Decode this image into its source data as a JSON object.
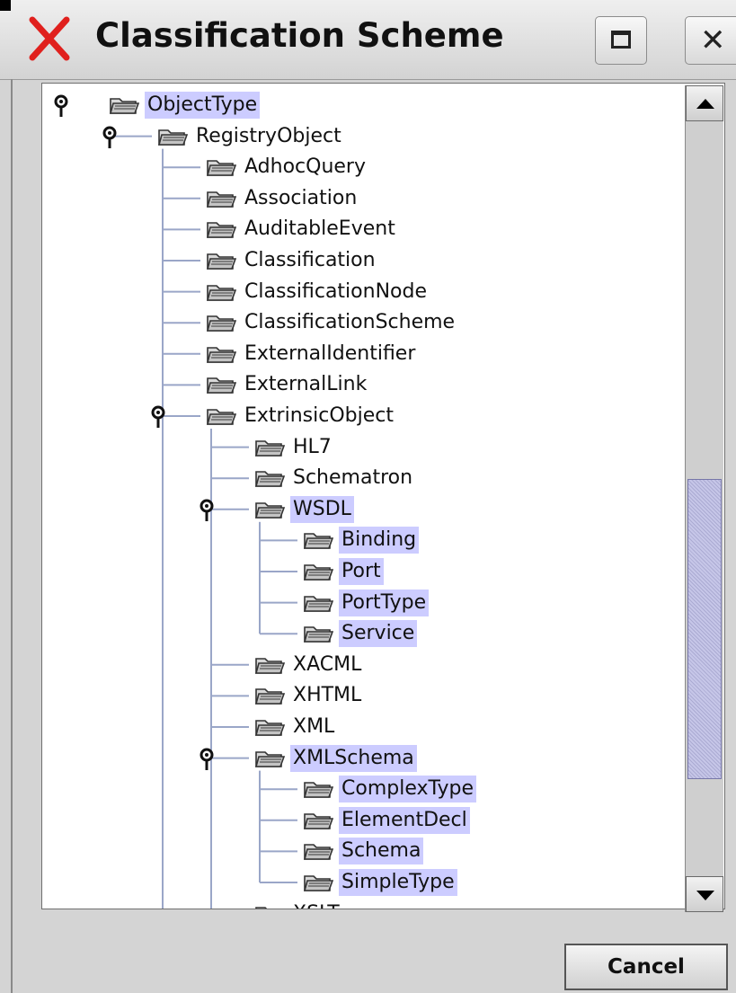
{
  "window": {
    "title": "Classification Scheme",
    "close_glyph": "✕",
    "cancel_label": "Cancel"
  },
  "icons": {
    "app": "red-x-icon",
    "maximize": "maximize-icon",
    "close": "close-icon",
    "node": "folder-icon",
    "expander": "tree-handle-expanded-icon"
  },
  "colors": {
    "selection": "#ccccff",
    "app_icon_red": "#e0201d",
    "scroll_thumb": "#c6c6e8"
  },
  "tree": [
    {
      "label": "ObjectType",
      "depth": 0,
      "expanded": true,
      "selected": true
    },
    {
      "label": "RegistryObject",
      "depth": 1,
      "expanded": true,
      "selected": false
    },
    {
      "label": "AdhocQuery",
      "depth": 2,
      "selected": false
    },
    {
      "label": "Association",
      "depth": 2,
      "selected": false
    },
    {
      "label": "AuditableEvent",
      "depth": 2,
      "selected": false
    },
    {
      "label": "Classification",
      "depth": 2,
      "selected": false
    },
    {
      "label": "ClassificationNode",
      "depth": 2,
      "selected": false
    },
    {
      "label": "ClassificationScheme",
      "depth": 2,
      "selected": false
    },
    {
      "label": "ExternalIdentifier",
      "depth": 2,
      "selected": false
    },
    {
      "label": "ExternalLink",
      "depth": 2,
      "selected": false
    },
    {
      "label": "ExtrinsicObject",
      "depth": 2,
      "expanded": true,
      "selected": false
    },
    {
      "label": "HL7",
      "depth": 3,
      "selected": false
    },
    {
      "label": "Schematron",
      "depth": 3,
      "selected": false
    },
    {
      "label": "WSDL",
      "depth": 3,
      "expanded": true,
      "selected": true
    },
    {
      "label": "Binding",
      "depth": 4,
      "selected": true
    },
    {
      "label": "Port",
      "depth": 4,
      "selected": true
    },
    {
      "label": "PortType",
      "depth": 4,
      "selected": true
    },
    {
      "label": "Service",
      "depth": 4,
      "selected": true
    },
    {
      "label": "XACML",
      "depth": 3,
      "selected": false
    },
    {
      "label": "XHTML",
      "depth": 3,
      "selected": false
    },
    {
      "label": "XML",
      "depth": 3,
      "selected": false
    },
    {
      "label": "XMLSchema",
      "depth": 3,
      "expanded": true,
      "selected": true
    },
    {
      "label": "ComplexType",
      "depth": 4,
      "selected": true
    },
    {
      "label": "ElementDecl",
      "depth": 4,
      "selected": true
    },
    {
      "label": "Schema",
      "depth": 4,
      "selected": true
    },
    {
      "label": "SimpleType",
      "depth": 4,
      "selected": true
    },
    {
      "label": "XSLT",
      "depth": 3,
      "selected": false
    }
  ]
}
